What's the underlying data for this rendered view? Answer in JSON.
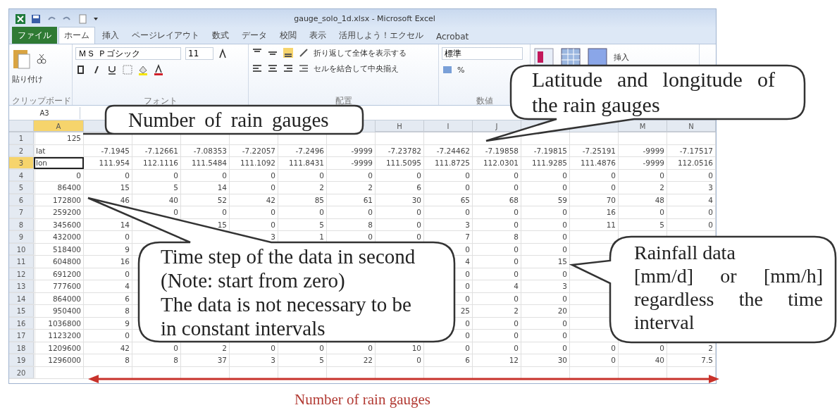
{
  "window": {
    "title": "gauge_solo_1d.xlsx - Microsoft Excel"
  },
  "ribbon_tabs": [
    {
      "label": "ファイル",
      "kind": "file",
      "selected": false
    },
    {
      "label": "ホーム",
      "kind": "tab",
      "selected": true
    },
    {
      "label": "挿入",
      "kind": "tab",
      "selected": false
    },
    {
      "label": "ページレイアウト",
      "kind": "tab",
      "selected": false
    },
    {
      "label": "数式",
      "kind": "tab",
      "selected": false
    },
    {
      "label": "データ",
      "kind": "tab",
      "selected": false
    },
    {
      "label": "校閲",
      "kind": "tab",
      "selected": false
    },
    {
      "label": "表示",
      "kind": "tab",
      "selected": false
    },
    {
      "label": "活用しよう！エクセル",
      "kind": "tab",
      "selected": false
    },
    {
      "label": "Acrobat",
      "kind": "tab",
      "selected": false
    }
  ],
  "ribbon": {
    "clipboard": {
      "paste": "貼り付け",
      "label": "クリップボード"
    },
    "font": {
      "name": "ＭＳ Ｐゴシック",
      "size": "11",
      "label": "フォント"
    },
    "alignment": {
      "wrap": "折り返して全体を表示する",
      "merge": "セルを結合して中央揃え",
      "label": "配置"
    },
    "number": {
      "format": "標準",
      "percent": "%",
      "label": "数値"
    },
    "cells": {
      "insert": "挿入"
    }
  },
  "name_box": "A3",
  "sheet": {
    "columns": [
      {
        "label": "A",
        "selected": true
      },
      {},
      {},
      {},
      {},
      {},
      {},
      {
        "label": "H",
        "selected": false
      },
      {
        "label": "I",
        "selected": false
      },
      {
        "label": "J",
        "selected": false
      },
      {},
      {},
      {
        "label": "M",
        "selected": false
      },
      {
        "label": "N",
        "selected": false
      }
    ],
    "rows": [
      {
        "label": "1",
        "selected": false,
        "cells": [
          "125",
          null,
          null,
          null,
          null,
          null,
          null,
          null,
          null,
          null,
          null,
          null,
          null,
          null
        ]
      },
      {
        "label": "2",
        "selected": false,
        "cells": [
          "lat",
          "-7.1945",
          "-7.12661",
          "-7.08353",
          "-7.22057",
          "-7.2496",
          "-9999",
          "-7.23782",
          "-7.24462",
          "-7.19858",
          "-7.19815",
          "-7.25191",
          "-9999",
          "-7.17517"
        ]
      },
      {
        "label": "3",
        "selected": true,
        "cells": [
          "lon",
          "111.954",
          "112.1116",
          "111.5484",
          "111.1092",
          "111.8431",
          "-9999",
          "111.5095",
          "111.8725",
          "112.0301",
          "111.9285",
          "111.4876",
          "-9999",
          "112.0516"
        ]
      },
      {
        "label": "4",
        "selected": false,
        "cells": [
          "0",
          "0",
          "0",
          "0",
          "0",
          "0",
          "0",
          "0",
          "0",
          "0",
          "0",
          "0",
          "0",
          "0"
        ]
      },
      {
        "label": "5",
        "selected": false,
        "cells": [
          "86400",
          "15",
          "5",
          "14",
          "0",
          "2",
          "2",
          "6",
          "0",
          "0",
          "0",
          "0",
          "2",
          "3"
        ]
      },
      {
        "label": "6",
        "selected": false,
        "cells": [
          "172800",
          "46",
          "40",
          "52",
          "42",
          "85",
          "61",
          "30",
          "65",
          "68",
          "59",
          "70",
          "48",
          "4"
        ]
      },
      {
        "label": "7",
        "selected": false,
        "cells": [
          "259200",
          null,
          "0",
          "0",
          "0",
          "0",
          "0",
          "0",
          "0",
          "0",
          "0",
          "16",
          "0",
          "0"
        ]
      },
      {
        "label": "8",
        "selected": false,
        "cells": [
          "345600",
          "14",
          null,
          "15",
          "0",
          "5",
          "8",
          "0",
          "3",
          "0",
          "0",
          "11",
          "5",
          "0"
        ]
      },
      {
        "label": "9",
        "selected": false,
        "cells": [
          "432000",
          "0",
          null,
          null,
          "3",
          "1",
          "0",
          "0",
          "7",
          "8",
          "0",
          null,
          null,
          null
        ]
      },
      {
        "label": "10",
        "selected": false,
        "cells": [
          "518400",
          "9",
          null,
          null,
          null,
          null,
          null,
          null,
          "0",
          "0",
          "0",
          null,
          null,
          null
        ]
      },
      {
        "label": "11",
        "selected": false,
        "cells": [
          "604800",
          "16",
          null,
          null,
          null,
          null,
          null,
          null,
          "4",
          "0",
          "15",
          null,
          null,
          null
        ]
      },
      {
        "label": "12",
        "selected": false,
        "cells": [
          "691200",
          "0",
          null,
          null,
          null,
          null,
          null,
          null,
          "0",
          "0",
          "0",
          null,
          null,
          null
        ]
      },
      {
        "label": "13",
        "selected": false,
        "cells": [
          "777600",
          "4",
          null,
          null,
          null,
          null,
          null,
          null,
          "0",
          "4",
          "3",
          null,
          null,
          null
        ]
      },
      {
        "label": "14",
        "selected": false,
        "cells": [
          "864000",
          "6",
          null,
          null,
          null,
          null,
          null,
          null,
          "0",
          "0",
          "0",
          null,
          null,
          null
        ]
      },
      {
        "label": "15",
        "selected": false,
        "cells": [
          "950400",
          "8",
          null,
          null,
          null,
          null,
          null,
          null,
          "25",
          "2",
          "20",
          null,
          null,
          null
        ]
      },
      {
        "label": "16",
        "selected": false,
        "cells": [
          "1036800",
          "9",
          null,
          null,
          null,
          null,
          null,
          null,
          "0",
          "0",
          "0",
          null,
          null,
          null
        ]
      },
      {
        "label": "17",
        "selected": false,
        "cells": [
          "1123200",
          "0",
          null,
          null,
          null,
          null,
          null,
          null,
          "0",
          "0",
          "0",
          null,
          null,
          null
        ]
      },
      {
        "label": "18",
        "selected": false,
        "cells": [
          "1209600",
          "42",
          "0",
          "2",
          "0",
          "0",
          "0",
          "10",
          "0",
          "0",
          "0",
          "0",
          "0",
          "2"
        ]
      },
      {
        "label": "19",
        "selected": false,
        "cells": [
          "1296000",
          "8",
          "8",
          "37",
          "3",
          "5",
          "22",
          "0",
          "6",
          "12",
          "30",
          "0",
          "40",
          "7.5"
        ]
      },
      {
        "label": "20",
        "selected": false,
        "cells": [
          null,
          null,
          null,
          null,
          null,
          null,
          null,
          null,
          null,
          null,
          null,
          null,
          null,
          null
        ]
      }
    ]
  },
  "callouts": [
    {
      "lines": [
        "Number of rain gauges"
      ]
    },
    {
      "lines": [
        "Latitude and longitude of the rain gauges"
      ]
    },
    {
      "lines": [
        "Time step of the data in second",
        "(Note: start from zero)",
        "The data is not necessary to be in constant intervals"
      ]
    },
    {
      "lines": [
        "Rainfall data",
        "[mm/d] or [mm/h] regardless the time interval"
      ]
    }
  ],
  "annotation": {
    "caption": "Number of rain gauges"
  }
}
